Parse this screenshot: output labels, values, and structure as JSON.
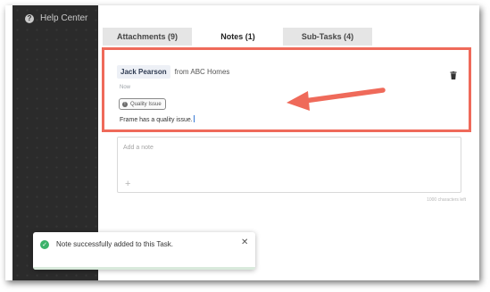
{
  "sidebar": {
    "help_label": "Help Center",
    "help_icon": "question-circle-icon"
  },
  "tabs": [
    {
      "label": "Attachments (9)",
      "active": false
    },
    {
      "label": "Notes (1)",
      "active": true
    },
    {
      "label": "Sub-Tasks (4)",
      "active": false
    }
  ],
  "note": {
    "author": "Jack Pearson",
    "from": "from ABC Homes",
    "time": "Now",
    "tag": "Quality Issue",
    "text": "Frame has a quality issue.",
    "highlight_color": "#ef6a5a"
  },
  "add_note": {
    "placeholder": "Add a note",
    "char_counter": "1000 characters left"
  },
  "toast": {
    "message": "Note successfully added to this Task.",
    "success_color": "#3bb26a"
  }
}
